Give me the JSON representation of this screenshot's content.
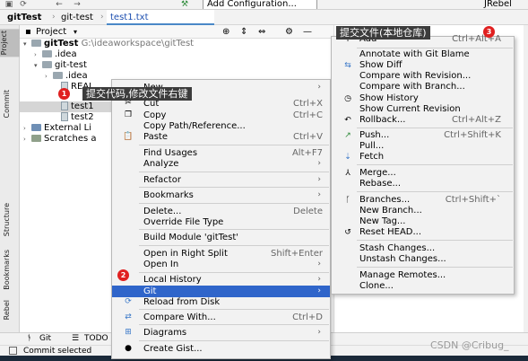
{
  "toolbar": {
    "config_label": "Add Configuration...",
    "jrebel_label": "JRebel"
  },
  "breadcrumb": {
    "items": [
      "gitTest",
      "git-test",
      "test1.txt"
    ]
  },
  "editor_tab": {
    "label": "test1.txt"
  },
  "left_stripe": {
    "tabs": [
      "Project",
      "Commit",
      "Structure",
      "Bookmarks",
      "Rebel"
    ]
  },
  "project_panel": {
    "title": "Project",
    "tree": [
      {
        "label": "gitTest",
        "path": "G:\\ideaworkspace\\gitTest",
        "kind": "folder",
        "expanded": true
      },
      {
        "label": ".idea",
        "kind": "folder",
        "expanded": false
      },
      {
        "label": "git-test",
        "kind": "folder",
        "expanded": true
      },
      {
        "label": ".idea",
        "kind": "folder",
        "expanded": false
      },
      {
        "label": "REAI",
        "kind": "file"
      },
      {
        "label": "test1",
        "kind": "file",
        "selected": true
      },
      {
        "label": "test1",
        "kind": "file"
      },
      {
        "label": "test2",
        "kind": "file"
      },
      {
        "label": "External Li",
        "kind": "library",
        "expanded": false
      },
      {
        "label": "Scratches a",
        "kind": "scratch",
        "expanded": false
      }
    ]
  },
  "context_menu": {
    "items": [
      {
        "label": "New",
        "submenu": true
      },
      {
        "label": "Cut",
        "shortcut": "Ctrl+X",
        "icon": "scissors-icon"
      },
      {
        "label": "Copy",
        "shortcut": "Ctrl+C",
        "icon": "copy-icon"
      },
      {
        "label": "Copy Path/Reference..."
      },
      {
        "label": "Paste",
        "shortcut": "Ctrl+V",
        "icon": "paste-icon"
      },
      {
        "label": "Find Usages",
        "shortcut": "Alt+F7"
      },
      {
        "label": "Analyze",
        "submenu": true
      },
      {
        "label": "Refactor",
        "submenu": true
      },
      {
        "label": "Bookmarks",
        "submenu": true
      },
      {
        "label": "Delete...",
        "shortcut": "Delete"
      },
      {
        "label": "Override File Type"
      },
      {
        "label": "Build Module 'gitTest'"
      },
      {
        "label": "Open in Right Split",
        "shortcut": "Shift+Enter"
      },
      {
        "label": "Open In",
        "submenu": true
      },
      {
        "label": "Local History",
        "submenu": true
      },
      {
        "label": "Git",
        "submenu": true,
        "highlighted": true
      },
      {
        "label": "Reload from Disk",
        "icon": "reload-icon"
      },
      {
        "label": "Compare With...",
        "shortcut": "Ctrl+D",
        "icon": "compare-icon"
      },
      {
        "label": "Diagrams",
        "submenu": true,
        "icon": "diagram-icon"
      },
      {
        "label": "Create Gist...",
        "icon": "github-icon"
      }
    ]
  },
  "git_menu": {
    "items": [
      {
        "label": "Add",
        "shortcut": "Ctrl+Alt+A",
        "icon": "plus-icon"
      },
      {
        "label": "Annotate with Git Blame"
      },
      {
        "label": "Show Diff",
        "icon": "diff-icon"
      },
      {
        "label": "Compare with Revision..."
      },
      {
        "label": "Compare with Branch..."
      },
      {
        "label": "Show History",
        "icon": "clock-icon"
      },
      {
        "label": "Show Current Revision"
      },
      {
        "label": "Rollback...",
        "shortcut": "Ctrl+Alt+Z",
        "icon": "rollback-icon"
      },
      {
        "label": "Push...",
        "shortcut": "Ctrl+Shift+K",
        "icon": "push-icon"
      },
      {
        "label": "Pull..."
      },
      {
        "label": "Fetch",
        "icon": "fetch-icon"
      },
      {
        "label": "Merge...",
        "icon": "merge-icon"
      },
      {
        "label": "Rebase..."
      },
      {
        "label": "Branches...",
        "shortcut": "Ctrl+Shift+`",
        "icon": "branch-icon"
      },
      {
        "label": "New Branch..."
      },
      {
        "label": "New Tag..."
      },
      {
        "label": "Reset HEAD...",
        "icon": "reset-icon"
      },
      {
        "label": "Stash Changes..."
      },
      {
        "label": "Unstash Changes..."
      },
      {
        "label": "Manage Remotes..."
      },
      {
        "label": "Clone..."
      }
    ]
  },
  "annotations": [
    {
      "number": "1",
      "text": "提交代码,修改文件右键"
    },
    {
      "number": "2",
      "text": ""
    },
    {
      "number": "3",
      "text": "提交文件(本地仓库)"
    }
  ],
  "bottom_bar": {
    "tabs": [
      "Git",
      "TODO"
    ]
  },
  "status_bar": {
    "text": "Commit selected"
  },
  "watermark": "CSDN @Cribug_",
  "colors": {
    "highlight": "#2f65ca",
    "annotation_badge": "#e02020",
    "callout_bg": "#3c3c3c"
  }
}
